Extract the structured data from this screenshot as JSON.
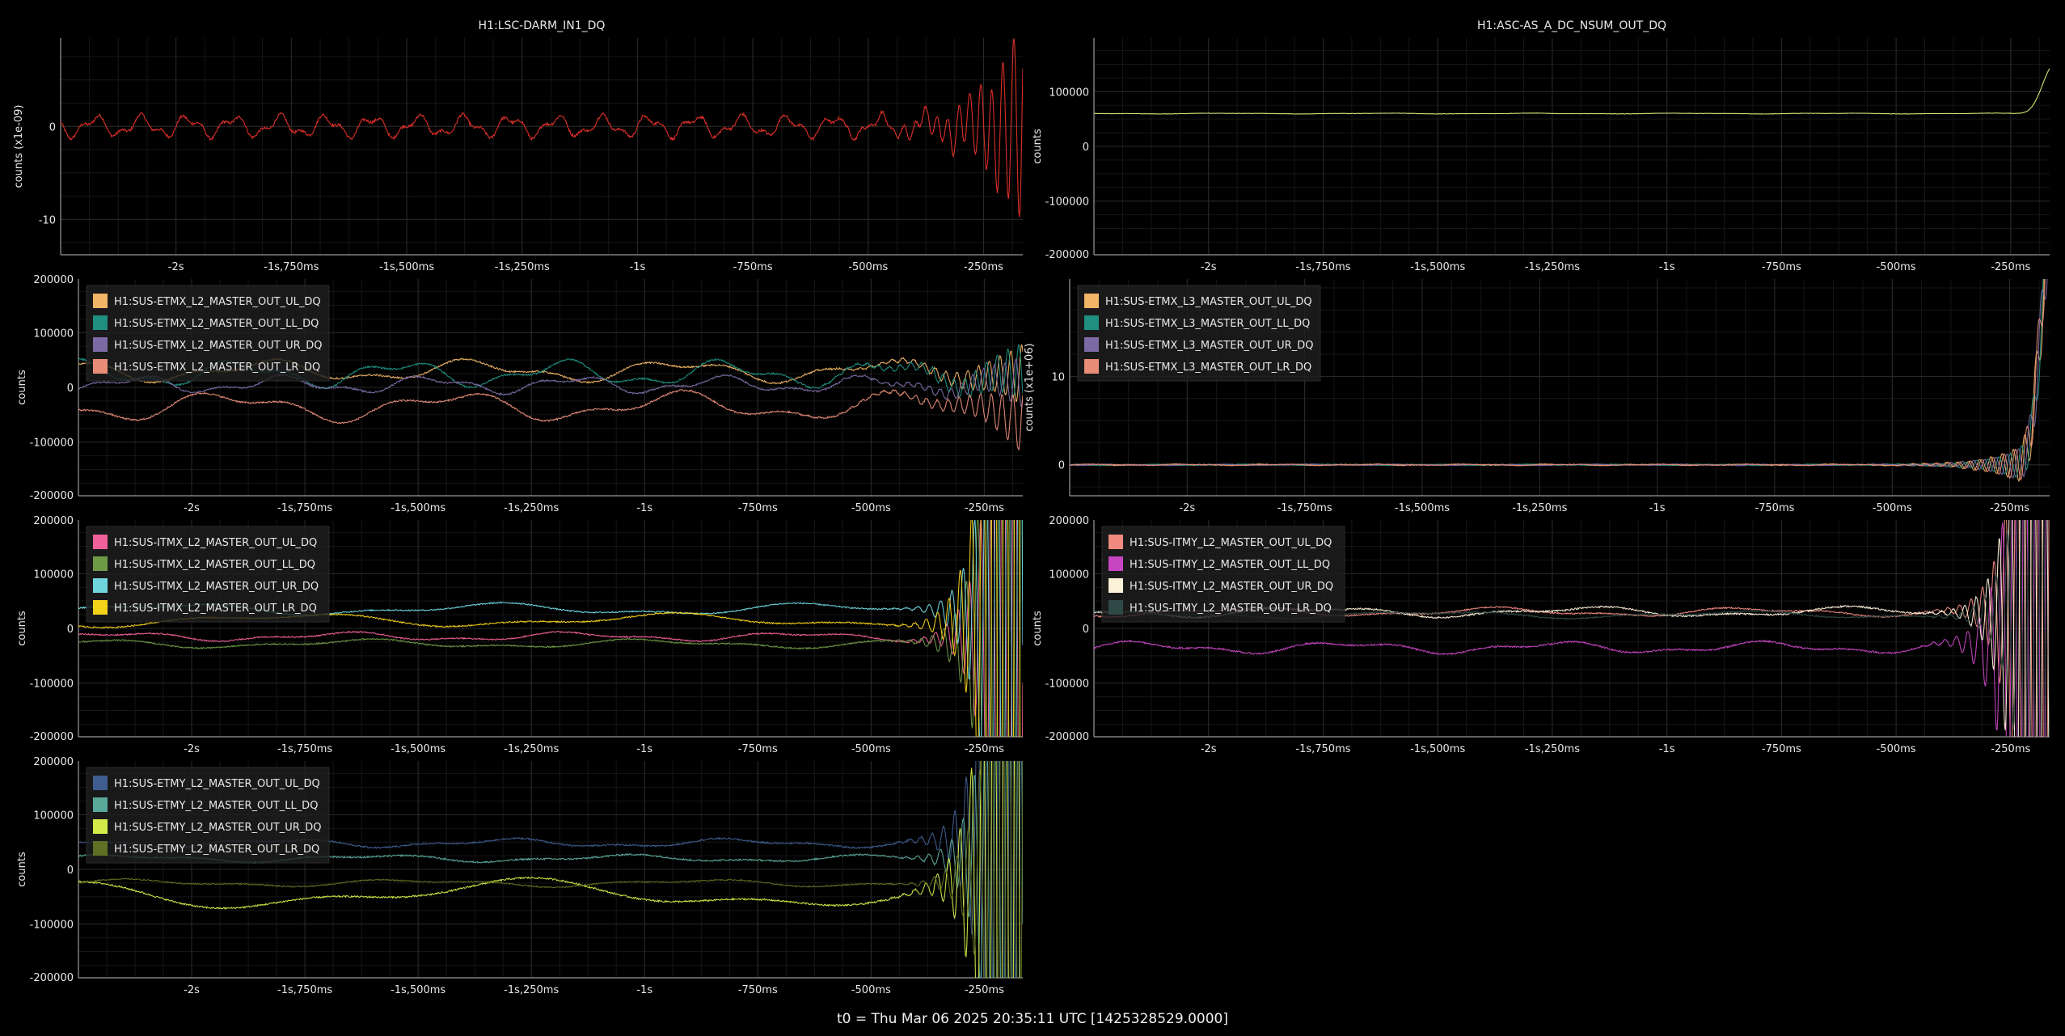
{
  "footer": {
    "t0_label": "t0 = Thu Mar 06 2025 20:35:11 UTC [1425328529.0000]"
  },
  "chart_data": [
    {
      "type": "line",
      "title": "H1:LSC-DARM_IN1_DQ",
      "ylabel": "counts (x1e-09)",
      "xlim": [
        -2.25,
        -0.165
      ],
      "ylim": [
        -13.8,
        9.5
      ],
      "yticks": [
        0,
        -10
      ],
      "xticks": [
        -2,
        -1.75,
        -1.5,
        -1.25,
        -1,
        -0.75,
        -0.5,
        -0.25
      ],
      "xtick_labels": [
        "-2s",
        "-1s,750ms",
        "-1s,500ms",
        "-1s,250ms",
        "-1s",
        "-750ms",
        "-500ms",
        "-250ms"
      ],
      "grid": true,
      "series": [
        {
          "name": "",
          "color": "#e8312a",
          "base": 0,
          "amp": 0.9,
          "freq": 10,
          "grow": 12,
          "gamp": 8.5,
          "gfreq": 42,
          "noise": 0.15
        }
      ]
    },
    {
      "type": "line",
      "title": "H1:ASC-AS_A_DC_NSUM_OUT_DQ",
      "ylabel": "counts",
      "xlim": [
        -2.25,
        -0.165
      ],
      "ylim": [
        -198000,
        198000
      ],
      "yticks": [
        100000,
        0,
        -100000,
        -200000
      ],
      "xticks": [
        -2,
        -1.75,
        -1.5,
        -1.25,
        -1,
        -0.75,
        -0.5,
        -0.25
      ],
      "xtick_labels": [
        "-2s",
        "-1s,750ms",
        "-1s,500ms",
        "-1s,250ms",
        "-1s",
        "-750ms",
        "-500ms",
        "-250ms"
      ],
      "grid": true,
      "series": [
        {
          "name": "",
          "color": "#d9ef7a",
          "base": 60000,
          "amp": 500,
          "freq": 3,
          "grow": 0,
          "gamp": 0,
          "gfreq": 0,
          "noise": 300,
          "spike": 70000
        }
      ]
    },
    {
      "type": "line",
      "title": "",
      "ylabel": "counts",
      "xlim": [
        -2.25,
        -0.165
      ],
      "ylim": [
        -198000,
        198000
      ],
      "yticks": [
        200000,
        100000,
        0,
        -100000,
        -200000
      ],
      "xticks": [
        -2,
        -1.75,
        -1.5,
        -1.25,
        -1,
        -0.75,
        -0.5,
        -0.25
      ],
      "xtick_labels": [
        "-2s",
        "-1s,750ms",
        "-1s,500ms",
        "-1s,250ms",
        "-1s",
        "-750ms",
        "-500ms",
        "-250ms"
      ],
      "grid": true,
      "legend": "top-left",
      "series": [
        {
          "name": "H1:SUS-ETMX_L2_MASTER_OUT_UL_DQ",
          "color": "#f0b566",
          "base": 30000,
          "amp": 15000,
          "freq": 2.2,
          "grow": 10,
          "gamp": 60000,
          "gfreq": 42,
          "noise": 1500
        },
        {
          "name": "H1:SUS-ETMX_L2_MASTER_OUT_LL_DQ",
          "color": "#1f8f7f",
          "base": 25000,
          "amp": 18000,
          "freq": 2.8,
          "grow": 9,
          "gamp": 70000,
          "gfreq": 42,
          "noise": 1500
        },
        {
          "name": "H1:SUS-ETMX_L2_MASTER_OUT_UR_DQ",
          "color": "#7b6aa3",
          "base": 5000,
          "amp": 12000,
          "freq": 3.1,
          "grow": 10,
          "gamp": 50000,
          "gfreq": 42,
          "noise": 1500
        },
        {
          "name": "H1:SUS-ETMX_L2_MASTER_OUT_LR_DQ",
          "color": "#e88d78",
          "base": -35000,
          "amp": 20000,
          "freq": 2.0,
          "grow": 10,
          "gamp": 60000,
          "gfreq": 42,
          "noise": 1500
        }
      ]
    },
    {
      "type": "line",
      "title": "",
      "ylabel": "counts (x1e+06)",
      "xlim": [
        -2.25,
        -0.165
      ],
      "ylim": [
        -3.5,
        21
      ],
      "yticks": [
        10,
        0
      ],
      "xticks": [
        -2,
        -1.75,
        -1.5,
        -1.25,
        -1,
        -0.75,
        -0.5,
        -0.25
      ],
      "xtick_labels": [
        "-2s",
        "-1s,750ms",
        "-1s,500ms",
        "-1s,250ms",
        "-1s",
        "-750ms",
        "-500ms",
        "-250ms"
      ],
      "grid": true,
      "legend": "top-left",
      "series": [
        {
          "name": "H1:SUS-ETMX_L3_MASTER_OUT_UL_DQ",
          "color": "#f0b566",
          "base": 0,
          "amp": 0.05,
          "freq": 5,
          "grow": 14,
          "gamp": 2.5,
          "gfreq": 42,
          "noise": 0.04,
          "spike": 24
        },
        {
          "name": "H1:SUS-ETMX_L3_MASTER_OUT_LL_DQ",
          "color": "#1f8f7f",
          "base": 0,
          "amp": 0.05,
          "freq": 5,
          "grow": 14,
          "gamp": 2.0,
          "gfreq": 42,
          "noise": 0.04,
          "spike": 22
        },
        {
          "name": "H1:SUS-ETMX_L3_MASTER_OUT_UR_DQ",
          "color": "#7b6aa3",
          "base": 0,
          "amp": 0.05,
          "freq": 5,
          "grow": 14,
          "gamp": 2.2,
          "gfreq": 42,
          "noise": 0.04,
          "spike": 23
        },
        {
          "name": "H1:SUS-ETMX_L3_MASTER_OUT_LR_DQ",
          "color": "#e88d78",
          "base": 0,
          "amp": 0.05,
          "freq": 5,
          "grow": 14,
          "gamp": 2.4,
          "gfreq": 42,
          "noise": 0.04,
          "spike": 25
        }
      ]
    },
    {
      "type": "line",
      "title": "",
      "ylabel": "counts",
      "xlim": [
        -2.25,
        -0.165
      ],
      "ylim": [
        -198000,
        198000
      ],
      "yticks": [
        200000,
        100000,
        0,
        -100000,
        -200000
      ],
      "xticks": [
        -2,
        -1.75,
        -1.5,
        -1.25,
        -1,
        -0.75,
        -0.5,
        -0.25
      ],
      "xtick_labels": [
        "-2s",
        "-1s,750ms",
        "-1s,500ms",
        "-1s,250ms",
        "-1s",
        "-750ms",
        "-500ms",
        "-250ms"
      ],
      "grid": true,
      "legend": "top-left",
      "series": [
        {
          "name": "H1:SUS-ITMX_L2_MASTER_OUT_UL_DQ",
          "color": "#f0609a",
          "base": -15000,
          "amp": 6000,
          "freq": 2.0,
          "grow": 30,
          "gamp": 90000,
          "gfreq": 40,
          "noise": 1200
        },
        {
          "name": "H1:SUS-ITMX_L2_MASTER_OUT_LL_DQ",
          "color": "#6e9a45",
          "base": -28000,
          "amp": 6000,
          "freq": 1.6,
          "grow": 30,
          "gamp": 120000,
          "gfreq": 40,
          "noise": 1200
        },
        {
          "name": "H1:SUS-ITMX_L2_MASTER_OUT_UR_DQ",
          "color": "#6fd6de",
          "base": 35000,
          "amp": 8000,
          "freq": 1.4,
          "grow": 30,
          "gamp": 110000,
          "gfreq": 40,
          "noise": 1200
        },
        {
          "name": "H1:SUS-ITMX_L2_MASTER_OUT_LR_DQ",
          "color": "#f5d21a",
          "base": 15000,
          "amp": 9000,
          "freq": 1.2,
          "grow": 30,
          "gamp": 150000,
          "gfreq": 40,
          "noise": 1200
        }
      ]
    },
    {
      "type": "line",
      "title": "",
      "ylabel": "counts",
      "xlim": [
        -2.25,
        -0.165
      ],
      "ylim": [
        -198000,
        198000
      ],
      "yticks": [
        200000,
        100000,
        0,
        -100000,
        -200000
      ],
      "xticks": [
        -2,
        -1.75,
        -1.5,
        -1.25,
        -1,
        -0.75,
        -0.5,
        -0.25
      ],
      "xtick_labels": [
        "-2s",
        "-1s,750ms",
        "-1s,500ms",
        "-1s,250ms",
        "-1s",
        "-750ms",
        "-500ms",
        "-250ms"
      ],
      "grid": true,
      "legend": "top-left",
      "series": [
        {
          "name": "H1:SUS-ITMY_L2_MASTER_OUT_UL_DQ",
          "color": "#f08a80",
          "base": 30000,
          "amp": 6000,
          "freq": 1.8,
          "grow": 30,
          "gamp": 90000,
          "gfreq": 40,
          "noise": 1200
        },
        {
          "name": "H1:SUS-ITMY_L2_MASTER_OUT_LL_DQ",
          "color": "#c646c2",
          "base": -35000,
          "amp": 8000,
          "freq": 2.2,
          "grow": 30,
          "gamp": 130000,
          "gfreq": 40,
          "noise": 1500
        },
        {
          "name": "H1:SUS-ITMY_L2_MASTER_OUT_UR_DQ",
          "color": "#fbf0d8",
          "base": 30000,
          "amp": 7000,
          "freq": 1.7,
          "grow": 30,
          "gamp": 100000,
          "gfreq": 40,
          "noise": 1500
        },
        {
          "name": "H1:SUS-ITMY_L2_MASTER_OUT_LR_DQ",
          "color": "#2f4a46",
          "base": 25000,
          "amp": 5000,
          "freq": 1.5,
          "grow": 30,
          "gamp": 60000,
          "gfreq": 40,
          "noise": 1200
        }
      ]
    },
    {
      "type": "line",
      "title": "",
      "ylabel": "counts",
      "xlim": [
        -2.25,
        -0.165
      ],
      "ylim": [
        -198000,
        198000
      ],
      "yticks": [
        200000,
        100000,
        0,
        -100000,
        -200000
      ],
      "xticks": [
        -2,
        -1.75,
        -1.5,
        -1.25,
        -1,
        -0.75,
        -0.5,
        -0.25
      ],
      "xtick_labels": [
        "-2s",
        "-1s,750ms",
        "-1s,500ms",
        "-1s,250ms",
        "-1s",
        "-750ms",
        "-500ms",
        "-250ms"
      ],
      "grid": true,
      "legend": "top-left",
      "series": [
        {
          "name": "H1:SUS-ETMY_L2_MASTER_OUT_UL_DQ",
          "color": "#3f5d8f",
          "base": 48000,
          "amp": 6000,
          "freq": 2.0,
          "grow": 30,
          "gamp": 130000,
          "gfreq": 40,
          "noise": 1500
        },
        {
          "name": "H1:SUS-ETMY_L2_MASTER_OUT_LL_DQ",
          "color": "#5aa89a",
          "base": 20000,
          "amp": 5000,
          "freq": 1.8,
          "grow": 30,
          "gamp": 100000,
          "gfreq": 40,
          "noise": 1500
        },
        {
          "name": "H1:SUS-ETMY_L2_MASTER_OUT_UR_DQ",
          "color": "#d3ea48",
          "base": -45000,
          "amp": 20000,
          "freq": 0.9,
          "grow": 30,
          "gamp": 160000,
          "gfreq": 40,
          "noise": 1500
        },
        {
          "name": "H1:SUS-ETMY_L2_MASTER_OUT_LR_DQ",
          "color": "#5f6f24",
          "base": -25000,
          "amp": 5000,
          "freq": 1.6,
          "grow": 30,
          "gamp": 90000,
          "gfreq": 40,
          "noise": 1200
        }
      ]
    }
  ]
}
